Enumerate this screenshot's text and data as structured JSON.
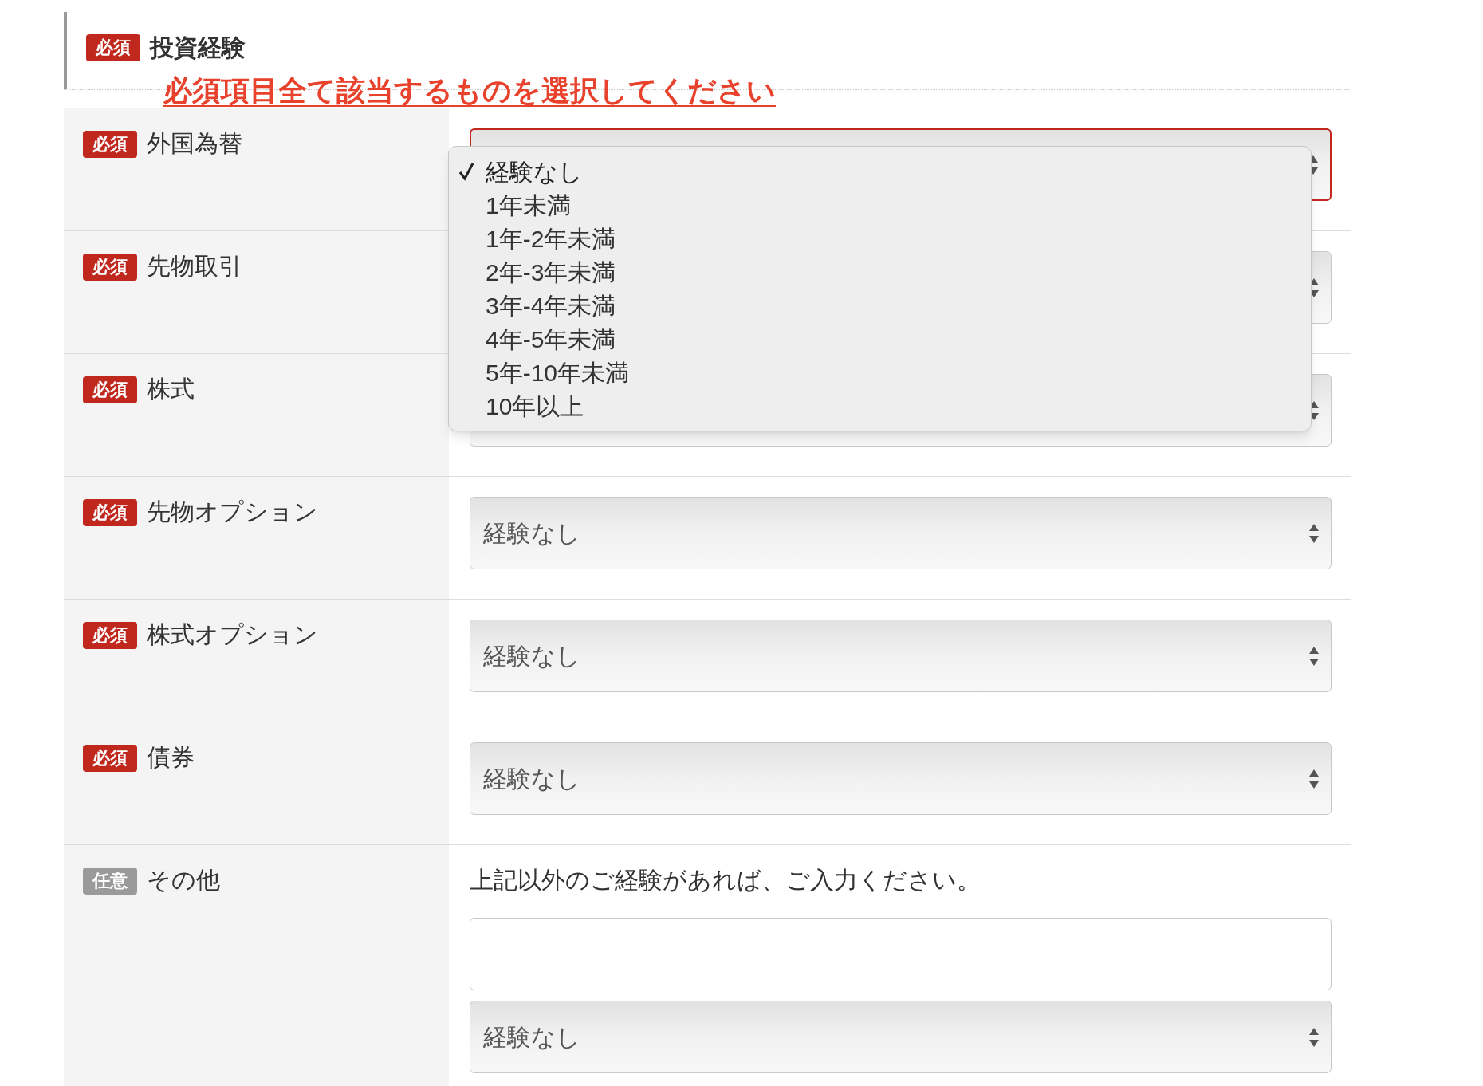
{
  "section": {
    "badge": "必須",
    "title": "投資経験",
    "warning": "必須項目全て該当するものを選択してください"
  },
  "rows": [
    {
      "kind": "select",
      "badge": "必須",
      "required": true,
      "label": "外国為替",
      "error": true,
      "open": true,
      "menu": [
        {
          "label": "経験なし",
          "selected": true
        },
        {
          "label": "1年未満",
          "selected": false
        },
        {
          "label": "1年-2年未満",
          "selected": false
        },
        {
          "label": "2年-3年未満",
          "selected": false
        },
        {
          "label": "3年-4年未満",
          "selected": false
        },
        {
          "label": "4年-5年未満",
          "selected": false
        },
        {
          "label": "5年-10年未満",
          "selected": false
        },
        {
          "label": "10年以上",
          "selected": false
        }
      ]
    },
    {
      "kind": "select",
      "badge": "必須",
      "required": true,
      "label": "先物取引",
      "error": false
    },
    {
      "kind": "select",
      "badge": "必須",
      "required": true,
      "label": "株式",
      "error": false
    },
    {
      "kind": "select",
      "badge": "必須",
      "required": true,
      "label": "先物オプション",
      "error": false,
      "value": "経験なし"
    },
    {
      "kind": "select",
      "badge": "必須",
      "required": true,
      "label": "株式オプション",
      "error": false,
      "value": "経験なし"
    },
    {
      "kind": "select",
      "badge": "必須",
      "required": true,
      "label": "債券",
      "error": false,
      "value": "経験なし"
    },
    {
      "kind": "text_and_select",
      "badge": "任意",
      "required": false,
      "label": "その他",
      "help": "上記以外のご経験があれば、ご入力ください。",
      "error": false,
      "value": "経験なし"
    }
  ]
}
